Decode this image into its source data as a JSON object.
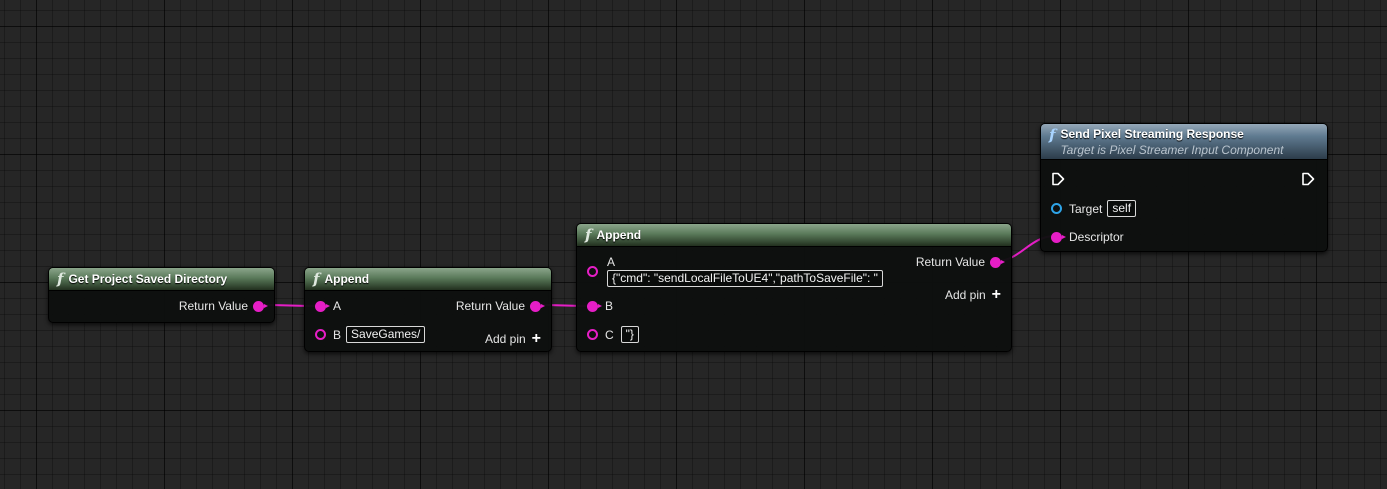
{
  "nodes": {
    "get_dir": {
      "title": "Get Project Saved Directory",
      "output": "Return Value"
    },
    "append1": {
      "title": "Append",
      "pin_a": "A",
      "pin_b": "B",
      "pin_b_value": "SaveGames/",
      "output": "Return Value",
      "add_pin": "Add pin"
    },
    "append2": {
      "title": "Append",
      "pin_a": "A",
      "pin_a_value": "{\"cmd\": \"sendLocalFileToUE4\",\"pathToSaveFile\": \"",
      "pin_b": "B",
      "pin_c": "C",
      "pin_c_value": "\"}",
      "output": "Return Value",
      "add_pin": "Add pin"
    },
    "send": {
      "title": "Send Pixel Streaming Response",
      "subtitle": "Target is Pixel Streamer Input Component",
      "target": "Target",
      "target_value": "self",
      "descriptor": "Descriptor"
    }
  },
  "colors": {
    "string_pin": "#e61ec6",
    "object_pin": "#2ea4e8",
    "pure_header": "#5a7a5a",
    "function_header": "#5f7a90"
  }
}
